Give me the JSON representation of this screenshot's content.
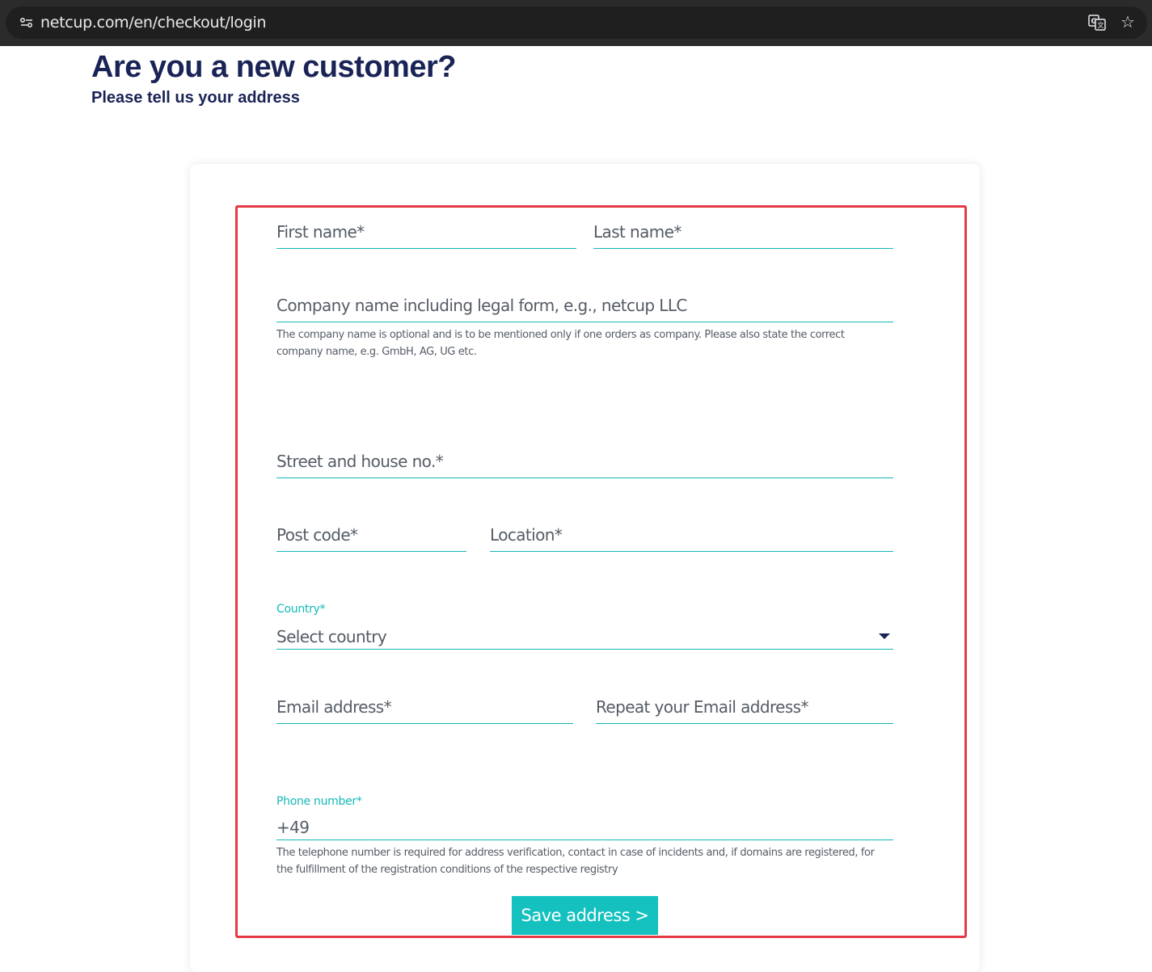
{
  "browser": {
    "url": "netcup.com/en/checkout/login",
    "icons": [
      "site-info-icon",
      "translate-icon",
      "bookmark-star-icon"
    ]
  },
  "page": {
    "title": "Are you a new customer?",
    "subtitle": "Please tell us your address"
  },
  "form": {
    "first_name": {
      "placeholder": "First name*"
    },
    "last_name": {
      "placeholder": "Last name*"
    },
    "company": {
      "placeholder": "Company name including legal form, e.g., netcup LLC",
      "hint": "The company name is optional and is to be mentioned only if one orders as company. Please also state the correct company name, e.g. GmbH, AG, UG etc."
    },
    "street": {
      "placeholder": "Street and house no.*"
    },
    "post_code": {
      "placeholder": "Post code*"
    },
    "location": {
      "placeholder": "Location*"
    },
    "country": {
      "label": "Country*",
      "selected": "Select country"
    },
    "email": {
      "placeholder": "Email address*"
    },
    "email_repeat": {
      "placeholder": "Repeat your Email address*"
    },
    "phone": {
      "label": "Phone number*",
      "value": "+49",
      "hint": "The telephone number is required for address verification, contact in case of incidents and, if domains are registered, for the fulfillment of the registration conditions of the respective registry"
    },
    "save_label": "Save address >"
  },
  "colors": {
    "heading": "#1a2356",
    "accent": "#14b8b8",
    "button": "#14c1bf",
    "highlight": "#e53945"
  }
}
